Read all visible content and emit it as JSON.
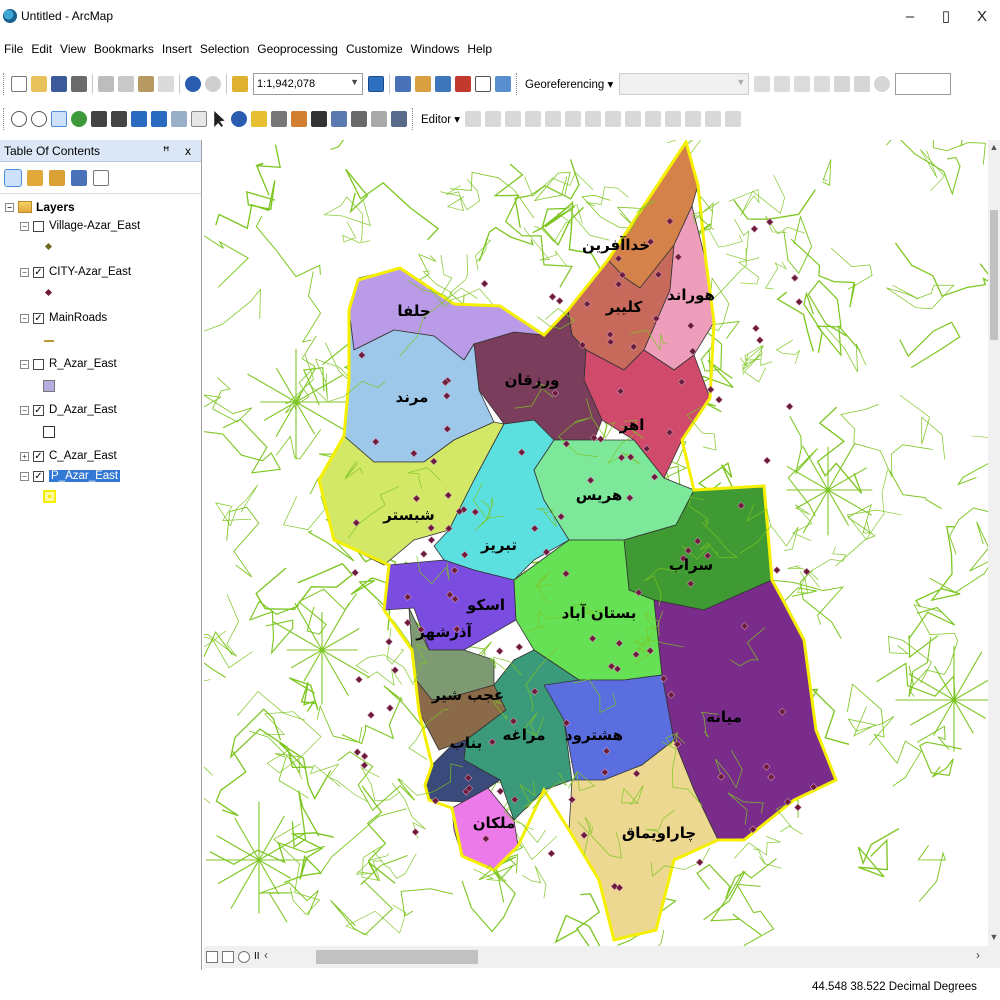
{
  "window": {
    "title": "Untitled - ArcMap",
    "controls": [
      "–",
      "▯",
      "X"
    ]
  },
  "menu": [
    "File",
    "Edit",
    "View",
    "Bookmarks",
    "Insert",
    "Selection",
    "Geoprocessing",
    "Customize",
    "Windows",
    "Help"
  ],
  "toolbar": {
    "scale": "1:1,942,078",
    "georeferencing_label": "Georeferencing ▾",
    "editor_label": "Editor ▾"
  },
  "toc": {
    "title": "Table Of Contents",
    "pin_icons": "ꟸ x",
    "root_label": "Layers",
    "layers": [
      {
        "name": "Village-Azar_East",
        "checked": false,
        "expanded": true,
        "selected": false,
        "symbol": "point-diamond"
      },
      {
        "name": "CITY-Azar_East",
        "checked": true,
        "expanded": true,
        "selected": false,
        "symbol": "point-diamond"
      },
      {
        "name": "MainRoads",
        "checked": true,
        "expanded": true,
        "selected": false,
        "symbol": "line"
      },
      {
        "name": "R_Azar_East",
        "checked": false,
        "expanded": true,
        "selected": false,
        "symbol": "fill-lavender"
      },
      {
        "name": "D_Azar_East",
        "checked": true,
        "expanded": true,
        "selected": false,
        "symbol": "fill-hollow"
      },
      {
        "name": "C_Azar_East",
        "checked": true,
        "expanded": false,
        "selected": false,
        "symbol": "none"
      },
      {
        "name": "P_Azar_East",
        "checked": true,
        "expanded": true,
        "selected": true,
        "symbol": "fill-yellow"
      }
    ]
  },
  "colors": {
    "accent": "#3378d4",
    "roads": "#7dc622",
    "boundary": "#f4f000",
    "city_point": "#6b1c3a"
  },
  "map": {
    "counties": [
      {
        "name": "خداآفرین",
        "color": "#d4824a"
      },
      {
        "name": "کلیبر",
        "color": "#c76a5c"
      },
      {
        "name": "هوراند",
        "color": "#ee9dbb"
      },
      {
        "name": "اهر",
        "color": "#cf4a6b"
      },
      {
        "name": "ورزقان",
        "color": "#7a3d5c"
      },
      {
        "name": "جلفا",
        "color": "#b99be8"
      },
      {
        "name": "مرند",
        "color": "#9ec8ea"
      },
      {
        "name": "شبستر",
        "color": "#d4e868"
      },
      {
        "name": "تبریز",
        "color": "#5ce0df"
      },
      {
        "name": "هریس",
        "color": "#7de89a"
      },
      {
        "name": "سراب",
        "color": "#3f9a33"
      },
      {
        "name": "اسکو",
        "color": "#7a4ce0"
      },
      {
        "name": "آذرشهر",
        "color": "#7d9a73"
      },
      {
        "name": "بستان آباد",
        "color": "#66e055"
      },
      {
        "name": "عجب شیر",
        "color": "#8a6a48"
      },
      {
        "name": "مراغه",
        "color": "#3a9a7a"
      },
      {
        "name": "هشترود",
        "color": "#5a6ee0"
      },
      {
        "name": "میانه",
        "color": "#7a2c8a"
      },
      {
        "name": "بناب",
        "color": "#3a4a7a"
      },
      {
        "name": "ملکان",
        "color": "#ec7ae8"
      },
      {
        "name": "چاراویماق",
        "color": "#ecd890"
      }
    ]
  },
  "status": {
    "coordinates": "44.548  38.522 Decimal Degrees"
  }
}
